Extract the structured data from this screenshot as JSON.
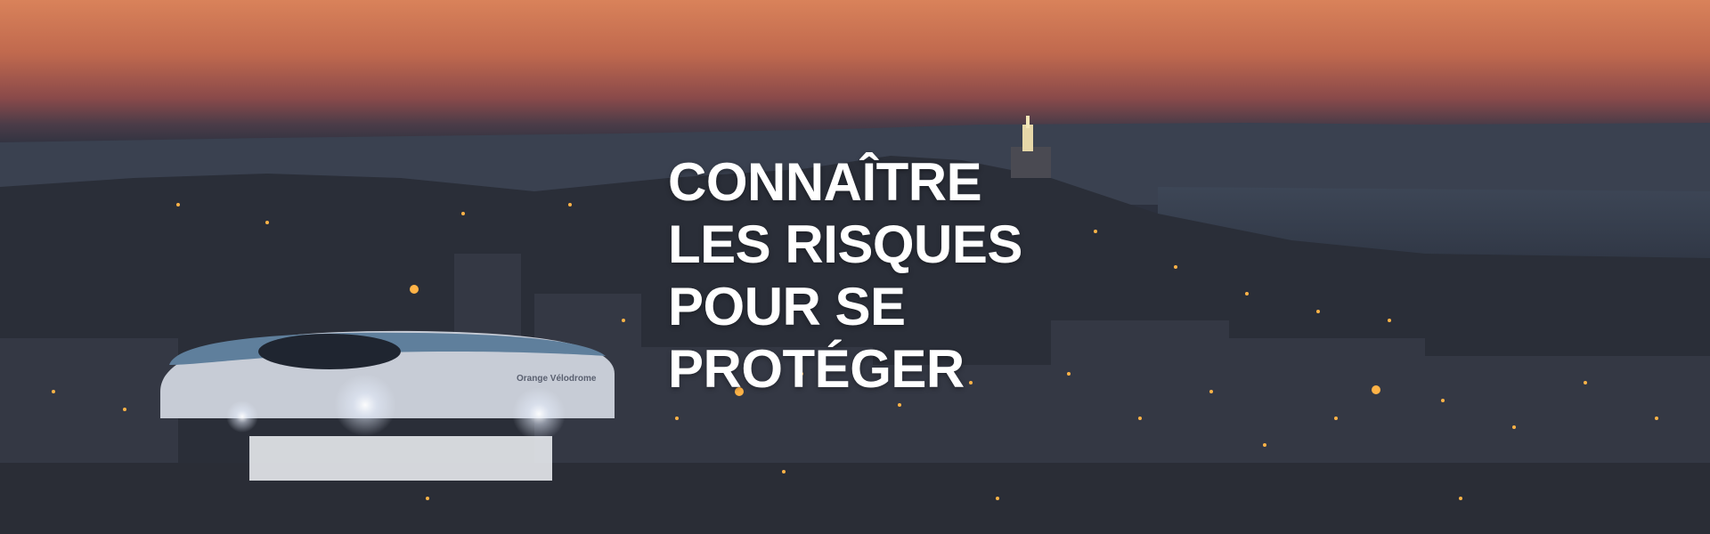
{
  "hero": {
    "headline_lines": [
      "CONNAÎTRE",
      "LES RISQUES",
      "POUR SE",
      "PROTÉGER"
    ],
    "stadium_sign": "Orange Vélodrome"
  },
  "colors": {
    "sky_top": "#d9825a",
    "sky_mid": "#8a4a4a",
    "city": "#262a35",
    "lights": "#ffb347",
    "headline": "#ffffff"
  }
}
